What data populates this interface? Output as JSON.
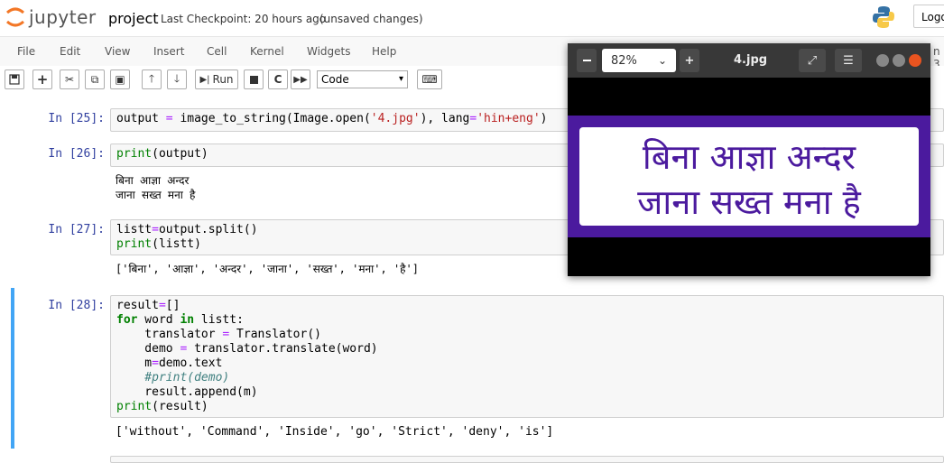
{
  "header": {
    "app_name": "jupyter",
    "notebook_name": "project",
    "checkpoint": "Last Checkpoint: 20 hours ago",
    "unsaved": "(unsaved changes)",
    "logout_label": "Logo"
  },
  "menubar": {
    "items": [
      "File",
      "Edit",
      "View",
      "Insert",
      "Cell",
      "Kernel",
      "Widgets",
      "Help"
    ],
    "right_fragment": "n 3"
  },
  "toolbar": {
    "run_label": "Run",
    "cell_type": "Code"
  },
  "cells": [
    {
      "prompt": "In [25]:",
      "code": "output = image_to_string(Image.open('4.jpg'), lang='hin+eng')"
    },
    {
      "prompt": "In [26]:",
      "code": "print(output)",
      "output": "बिना आज्ञा अन्दर\nजाना सख्त मना है"
    },
    {
      "prompt": "In [27]:",
      "code": "listt=output.split()\nprint(listt)",
      "output": "['बिना', 'आज्ञा', 'अन्दर', 'जाना', 'सख्त', 'मना', 'है']"
    },
    {
      "prompt": "In [28]:",
      "code": "result=[]\nfor word in listt:\n    translator = Translator()\n    demo = translator.translate(word)\n    m=demo.text\n    #print(demo)\n    result.append(m)\nprint(result)",
      "output": "['without', 'Command', 'Inside', 'go', 'Strict', 'deny', 'is']"
    }
  ],
  "image_viewer": {
    "zoom": "82%",
    "title": "4.jpg",
    "sign_line1": "बिना आज्ञा अन्दर",
    "sign_line2": "जाना सख्त मना है"
  },
  "colors": {
    "accent_selection": "#42a5f5",
    "sign_purple": "#4b1a9e",
    "prompt_blue": "#303f9f"
  }
}
